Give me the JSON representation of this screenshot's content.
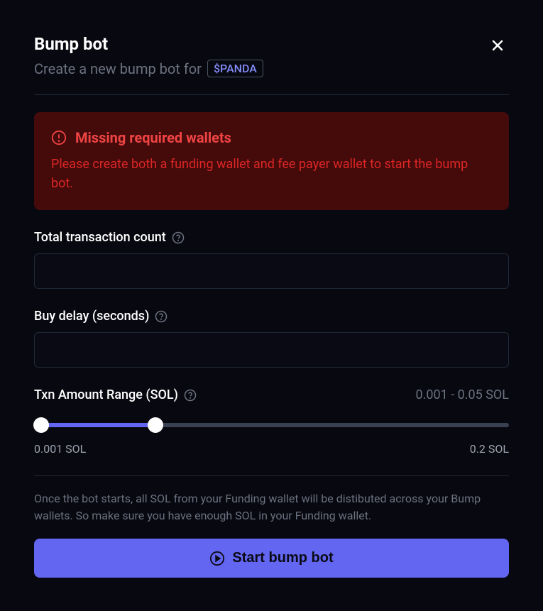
{
  "header": {
    "title": "Bump bot",
    "subtitle_prefix": "Create a new bump bot for",
    "token": "$PANDA"
  },
  "alert": {
    "title": "Missing required wallets",
    "body": "Please create both a funding wallet and fee payer wallet to start the bump bot."
  },
  "fields": {
    "txn_count": {
      "label": "Total transaction count",
      "value": ""
    },
    "buy_delay": {
      "label": "Buy delay (seconds)",
      "value": ""
    },
    "range": {
      "label": "Txn Amount Range (SOL)",
      "value_display": "0.001 - 0.05 SOL",
      "min_label": "0.001 SOL",
      "max_label": "0.2 SOL",
      "min": 0.001,
      "max": 0.2,
      "low": 0.001,
      "high": 0.05
    }
  },
  "footer": {
    "note": "Once the bot starts, all SOL from your Funding wallet will be distibuted across your Bump wallets. So make sure you have enough SOL in your Funding wallet.",
    "button": "Start bump bot"
  }
}
